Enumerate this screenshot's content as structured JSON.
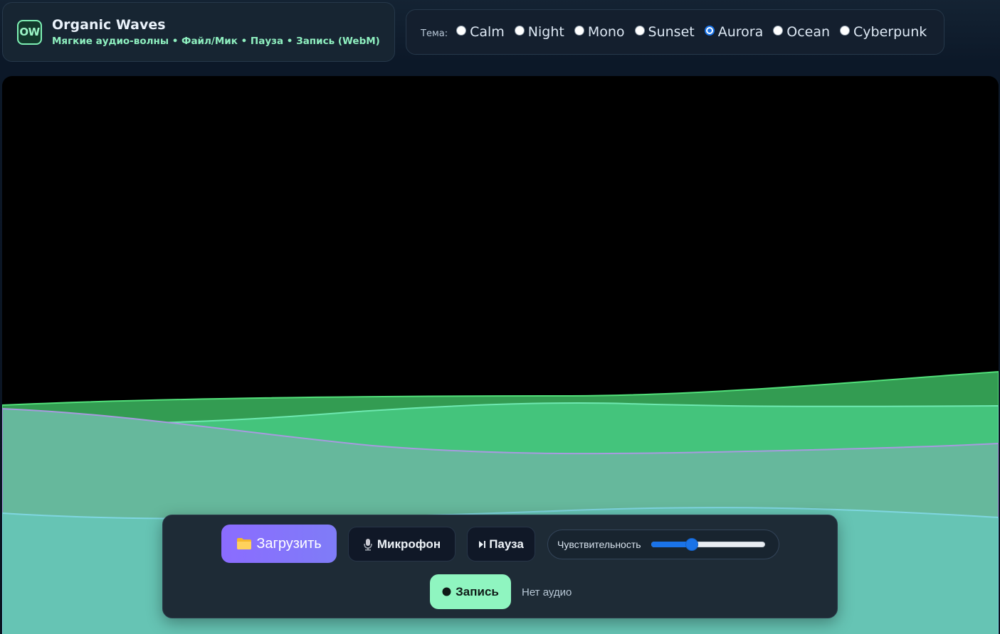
{
  "brand": {
    "logo_text": "OW",
    "title": "Organic Waves",
    "subtitle": "Мягкие аудио-волны • Файл/Мик • Пауза • Запись (WebM)"
  },
  "themes": {
    "label": "Тема:",
    "selected": "Aurora",
    "options": [
      "Calm",
      "Night",
      "Mono",
      "Sunset",
      "Aurora",
      "Ocean",
      "Cyberpunk"
    ]
  },
  "controls": {
    "upload_label": "Загрузить",
    "upload_icon": "folder-icon",
    "mic_label": "Микрофон",
    "mic_icon": "microphone-icon",
    "pause_label": "Пауза",
    "pause_icon": "play-pause-icon",
    "sensitivity_label": "Чувствительность",
    "sensitivity_value": 0.36,
    "record_label": "Запись",
    "record_icon": "record-dot-icon",
    "status": "Нет аудио"
  },
  "colors": {
    "upload_bg": "#8b6cff",
    "record_bg": "#8ff5c0",
    "accent": "#1a73e8",
    "wave_green_dark": "#339c52",
    "wave_green": "#44c47c",
    "wave_sage": "#66b89c",
    "wave_teal": "#66c4b4"
  }
}
